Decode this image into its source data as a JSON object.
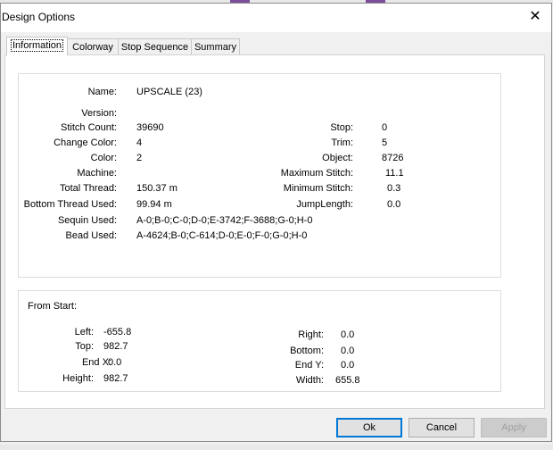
{
  "dialog": {
    "title": "Design Options",
    "close_glyph": "✕"
  },
  "tabs": [
    "Information",
    "Colorway",
    "Stop Sequence",
    "Summary"
  ],
  "info": {
    "name": {
      "label": "Name:",
      "value": "UPSCALE (23)"
    },
    "version": {
      "label": "Version:",
      "value": ""
    },
    "stitch_count": {
      "label": "Stitch Count:",
      "value": "39690"
    },
    "change_color": {
      "label": "Change Color:",
      "value": "4"
    },
    "color": {
      "label": "Color:",
      "value": "2"
    },
    "machine": {
      "label": "Machine:",
      "value": ""
    },
    "total_thread": {
      "label": "Total Thread:",
      "value": "150.37 m"
    },
    "bottom_thread": {
      "label": "Bottom Thread Used:",
      "value": "99.94 m"
    },
    "sequin_used": {
      "label": "Sequin Used:",
      "value": "A-0;B-0;C-0;D-0;E-3742;F-3688;G-0;H-0"
    },
    "bead_used": {
      "label": "Bead Used:",
      "value": "A-4624;B-0;C-614;D-0;E-0;F-0;G-0;H-0"
    },
    "stop": {
      "label": "Stop:",
      "value": "0"
    },
    "trim": {
      "label": "Trim:",
      "value": "5"
    },
    "object": {
      "label": "Object:",
      "value": "8726"
    },
    "max_stitch": {
      "label": "Maximum Stitch:",
      "value": "11.1"
    },
    "min_stitch": {
      "label": "Minimum Stitch:",
      "value": "0.3"
    },
    "jump_length": {
      "label": "JumpLength:",
      "value": "0.0"
    }
  },
  "from_start": {
    "heading": "From Start:",
    "left": {
      "label": "Left:",
      "value": "-655.8"
    },
    "top": {
      "label": "Top:",
      "value": "982.7"
    },
    "end_x": {
      "label": "End X:",
      "value": "0.0"
    },
    "height": {
      "label": "Height:",
      "value": "982.7"
    },
    "right": {
      "label": "Right:",
      "value": "0.0"
    },
    "bottom": {
      "label": "Bottom:",
      "value": "0.0"
    },
    "end_y": {
      "label": "End Y:",
      "value": "0.0"
    },
    "width": {
      "label": "Width:",
      "value": "655.8"
    }
  },
  "buttons": {
    "ok": "Ok",
    "cancel": "Cancel",
    "apply": "Apply"
  }
}
